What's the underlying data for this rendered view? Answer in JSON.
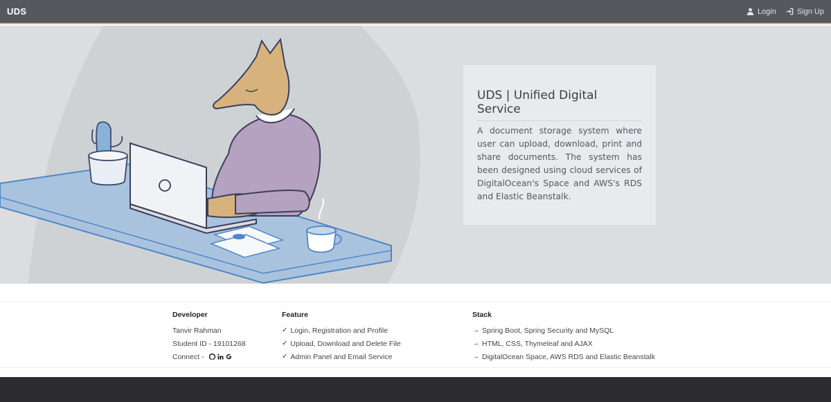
{
  "nav": {
    "brand": "UDS",
    "login_label": "Login",
    "signup_label": "Sign Up",
    "login_icon": "user-icon",
    "signup_icon": "sign-in-icon"
  },
  "hero": {
    "title": "UDS | Unified Digital Service",
    "description": "A document storage system where user can upload, download, print and share documents. The system has been designed using cloud services of DigitalOcean's Space and AWS's RDS and Elastic Beanstalk."
  },
  "footer": {
    "developer": {
      "heading": "Developer",
      "name": "Tanvir Rahman",
      "student_id": "Student ID - 19101268",
      "connect_label": "Connect -",
      "links": [
        "github-icon",
        "linkedin-icon",
        "google-icon"
      ]
    },
    "feature": {
      "heading": "Feature",
      "items": [
        "Login, Registration and Profile",
        "Upload, Download and Delete File",
        "Admin Panel and Email Service"
      ]
    },
    "stack": {
      "heading": "Stack",
      "items": [
        "Spring Boot, Spring Security and MySQL",
        "HTML, CSS, Thymeleaf and AJAX",
        "DigitalOcean Space, AWS RDS and Elastic Beanstalk"
      ]
    }
  },
  "colors": {
    "navbar": "#55585e",
    "navbar_border": "#e0b24a",
    "hero_bg": "#dcdde0",
    "card_bg": "#e9eaee",
    "bottom_bar": "#2c2c30"
  }
}
